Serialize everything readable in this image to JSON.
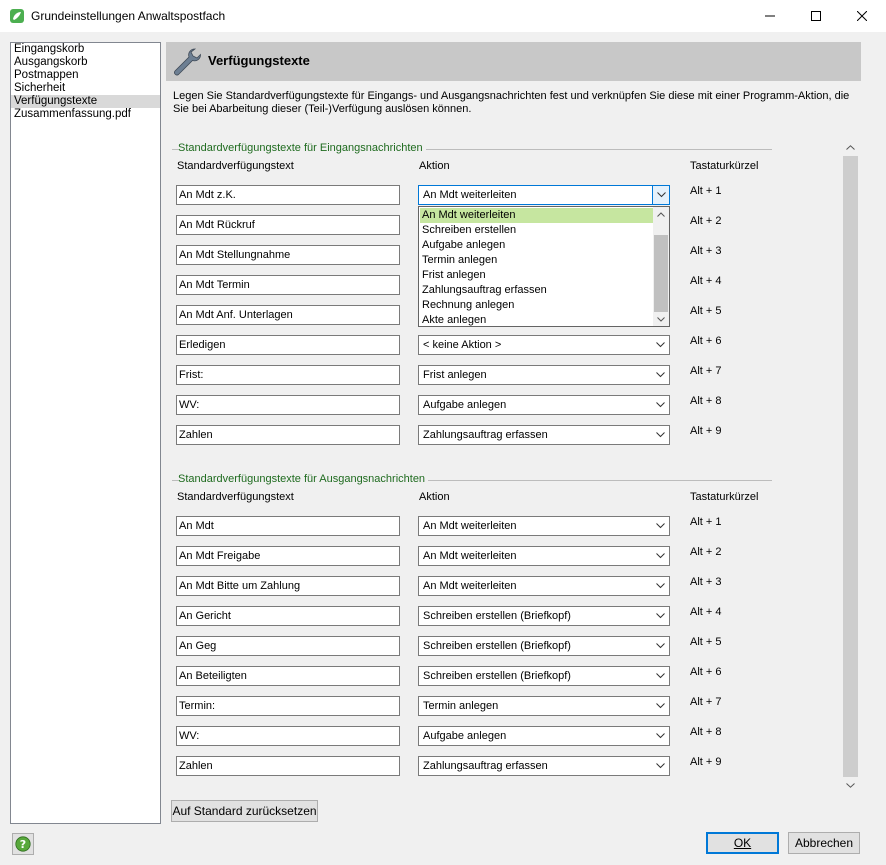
{
  "window": {
    "title": "Grundeinstellungen Anwaltspostfach"
  },
  "nav": {
    "items": [
      {
        "label": "Eingangskorb"
      },
      {
        "label": "Ausgangskorb"
      },
      {
        "label": "Postmappen"
      },
      {
        "label": "Sicherheit"
      },
      {
        "label": "Verfügungstexte",
        "selected": true
      },
      {
        "label": "Zusammenfassung.pdf"
      }
    ]
  },
  "header": {
    "title": "Verfügungstexte",
    "icon": "wrench-icon"
  },
  "description": "Legen Sie Standardverfügungstexte für Eingangs- und Ausgangsnachrichten fest und verknüpfen Sie diese mit einer Programm-Aktion, die Sie bei Abarbeitung dieser (Teil-)Verfügung auslösen können.",
  "incoming": {
    "legend": "Standardverfügungstexte für Eingangsnachrichten",
    "col_text": "Standardverfügungstext",
    "col_action": "Aktion",
    "col_key": "Tastaturkürzel",
    "rows": [
      {
        "text": "An Mdt z.K.",
        "action": "An Mdt weiterleiten",
        "key": "Alt + 1"
      },
      {
        "text": "An Mdt Rückruf",
        "action": "",
        "key": "Alt + 2"
      },
      {
        "text": "An Mdt Stellungnahme",
        "action": "",
        "key": "Alt + 3"
      },
      {
        "text": "An Mdt Termin",
        "action": "",
        "key": "Alt + 4"
      },
      {
        "text": "An Mdt Anf. Unterlagen",
        "action": "",
        "key": "Alt + 5"
      },
      {
        "text": "Erledigen",
        "action": "< keine Aktion >",
        "key": "Alt + 6"
      },
      {
        "text": "Frist:",
        "action": "Frist anlegen",
        "key": "Alt + 7"
      },
      {
        "text": "WV:",
        "action": "Aufgabe anlegen",
        "key": "Alt + 8"
      },
      {
        "text": "Zahlen",
        "action": "Zahlungsauftrag erfassen",
        "key": "Alt + 9"
      }
    ]
  },
  "dropdown_list": {
    "items": [
      "An Mdt weiterleiten",
      "Schreiben erstellen",
      "Aufgabe anlegen",
      "Termin anlegen",
      "Frist anlegen",
      "Zahlungsauftrag erfassen",
      "Rechnung anlegen",
      "Akte anlegen"
    ],
    "highlighted": "An Mdt weiterleiten"
  },
  "outgoing": {
    "legend": "Standardverfügungstexte für Ausgangsnachrichten",
    "col_text": "Standardverfügungstext",
    "col_action": "Aktion",
    "col_key": "Tastaturkürzel",
    "rows": [
      {
        "text": "An Mdt",
        "action": "An Mdt weiterleiten",
        "key": "Alt + 1"
      },
      {
        "text": "An Mdt Freigabe",
        "action": "An Mdt weiterleiten",
        "key": "Alt + 2"
      },
      {
        "text": "An Mdt Bitte um Zahlung",
        "action": "An Mdt weiterleiten",
        "key": "Alt + 3"
      },
      {
        "text": "An Gericht",
        "action": "Schreiben erstellen (Briefkopf)",
        "key": "Alt + 4"
      },
      {
        "text": "An Geg",
        "action": "Schreiben erstellen (Briefkopf)",
        "key": "Alt + 5"
      },
      {
        "text": "An Beteiligten",
        "action": "Schreiben erstellen (Briefkopf)",
        "key": "Alt + 6"
      },
      {
        "text": "Termin:",
        "action": "Termin anlegen",
        "key": "Alt + 7"
      },
      {
        "text": "WV:",
        "action": "Aufgabe anlegen",
        "key": "Alt + 8"
      },
      {
        "text": "Zahlen",
        "action": "Zahlungsauftrag erfassen",
        "key": "Alt + 9"
      }
    ]
  },
  "buttons": {
    "reset": "Auf Standard zurücksetzen",
    "ok": "OK",
    "cancel": "Abbrechen"
  },
  "colors": {
    "legend_text": "#1f6b1f",
    "highlight": "#c6e6a0",
    "focus": "#0078d7",
    "header_bg": "#c8c8c8"
  }
}
